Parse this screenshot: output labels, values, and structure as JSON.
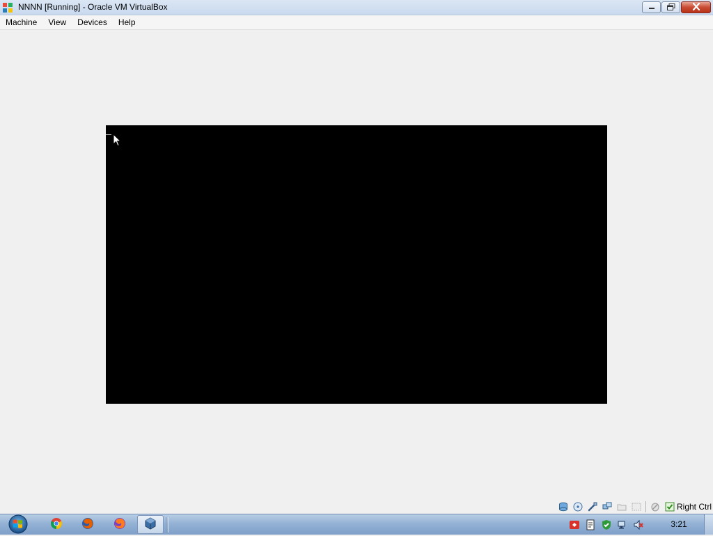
{
  "window": {
    "title": "NNNN [Running] - Oracle VM VirtualBox",
    "controls": {
      "minimize": "minimize-icon",
      "maximize": "restore-icon",
      "close": "close-icon"
    }
  },
  "menu": {
    "items": [
      {
        "label": "Machine"
      },
      {
        "label": "View"
      },
      {
        "label": "Devices"
      },
      {
        "label": "Help"
      }
    ]
  },
  "vm_screen": {
    "background": "#000000"
  },
  "statusbar": {
    "icons": [
      "hard-disk-icon",
      "optical-drive-icon",
      "usb-icon",
      "network-icon",
      "shared-folders-icon",
      "display-icon",
      "mouse-integration-icon",
      "keyboard-capture-icon"
    ],
    "host_key": "Right Ctrl"
  },
  "taskbar": {
    "start_icon": "windows-start-icon",
    "apps": [
      {
        "name": "chrome-icon"
      },
      {
        "name": "firefox-icon"
      },
      {
        "name": "firefox-icon"
      },
      {
        "name": "virtualbox-icon",
        "active": true
      }
    ],
    "tray_icons": [
      "red-alert-icon",
      "document-icon",
      "security-icon",
      "network-tray-icon",
      "volume-muted-icon"
    ],
    "clock": "3:21"
  }
}
